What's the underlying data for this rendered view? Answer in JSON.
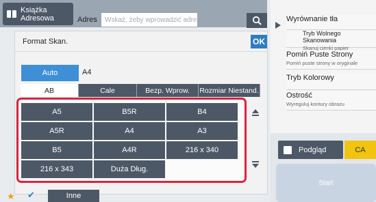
{
  "topbar": {
    "address_book_label": "Książka\nAdresowa",
    "address_label": "Adres",
    "address_placeholder": "Wskaż, żeby wprowadzić adres"
  },
  "right_panel": {
    "items": [
      {
        "title": "Wyrównanie tła",
        "sub": ""
      },
      {
        "title": "Tryb Wolnego Skanowania",
        "sub": "Skanuj cienki papier"
      },
      {
        "title": "Pomiń Puste Strony",
        "sub": "Pomiń puste strony w oryginale"
      },
      {
        "title": "Tryb Kolorowy",
        "sub": ""
      },
      {
        "title": "Ostrość",
        "sub": "Wyreguluj kontury obrazu"
      }
    ],
    "preview_label": "Podgląd",
    "ca_label": "CA",
    "start_label": "Start"
  },
  "dialog": {
    "title": "Format Skan.",
    "ok_label": "OK",
    "auto_label": "Auto",
    "selected_size": "A4",
    "tabs": [
      {
        "label": "AB",
        "active": true
      },
      {
        "label": "Cale",
        "active": false
      },
      {
        "label": "Bezp. Wprow.",
        "active": false
      },
      {
        "label": "Rozmiar Niestand.",
        "active": false
      }
    ],
    "sizes": [
      "A5",
      "B5R",
      "B4",
      "A5R",
      "A4",
      "A3",
      "B5",
      "A4R",
      "216 x 340",
      "216 x 343",
      "Duża Dług."
    ]
  },
  "bottom": {
    "other_label": "Inne"
  },
  "colors": {
    "button_dark": "#4c5866",
    "accent_blue": "#3e8fd6",
    "highlight_red": "#d9233f",
    "ca_yellow": "#f1c40f"
  }
}
